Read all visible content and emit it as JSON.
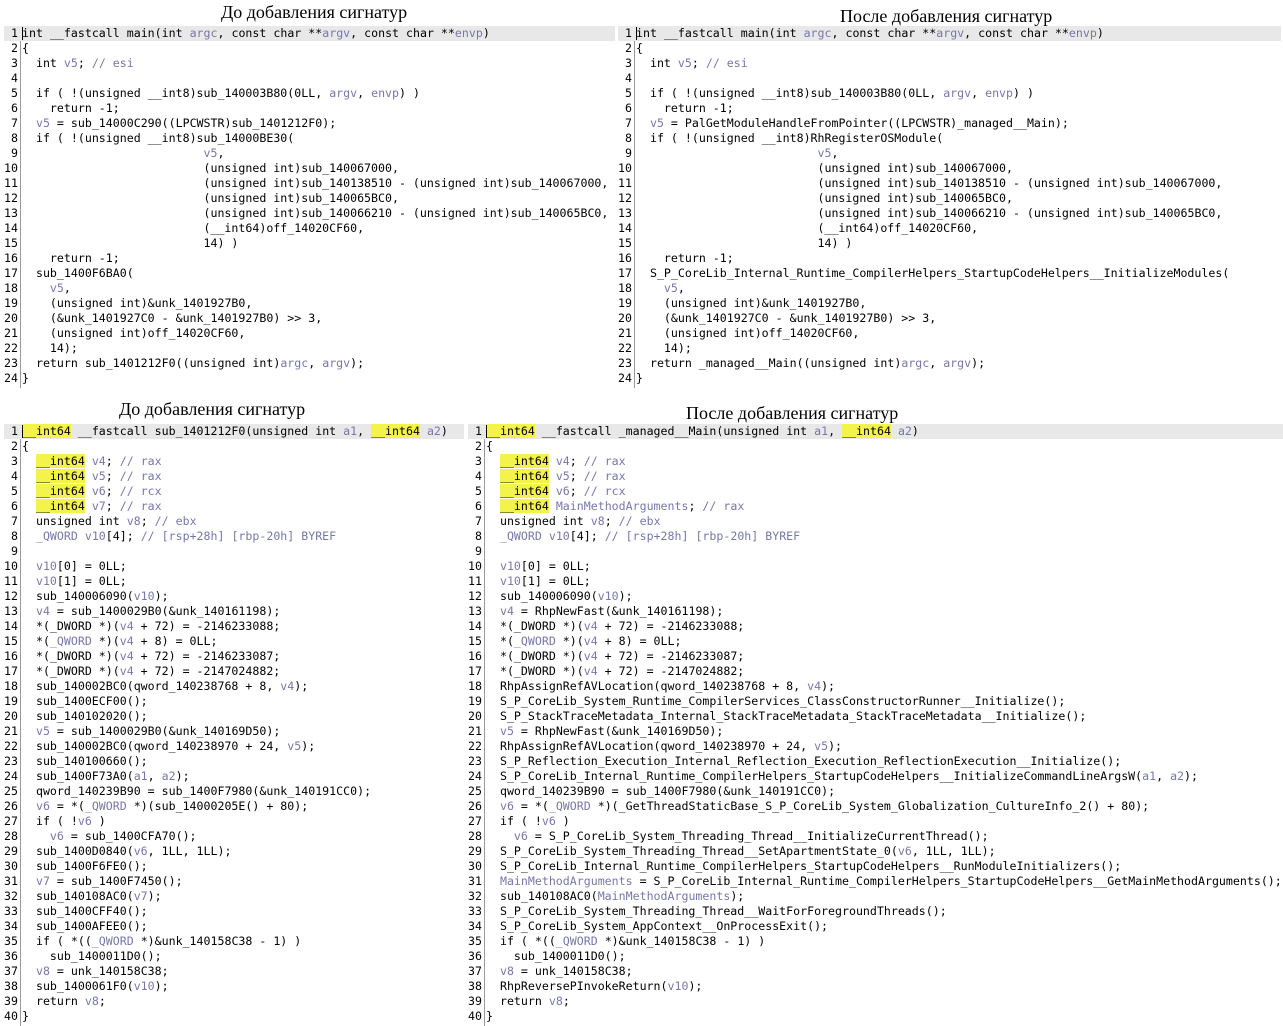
{
  "headings": {
    "top_left": "До добавления сигнатур",
    "top_right": "После добавления сигнатур",
    "bottom_left": "До добавления сигнатур",
    "bottom_right": "После добавления сигнатур"
  },
  "colors": {
    "variable": "#7777aa",
    "type_highlight": "#f3f34a",
    "line_highlight": "#e8e8e8"
  },
  "panes": {
    "top_left": {
      "lines": [
        "int __fastcall main(int argc, const char **argv, const char **envp)",
        "{",
        "  int v5; // esi",
        "",
        "  if ( !(unsigned __int8)sub_140003B80(0LL, argv, envp) )",
        "    return -1;",
        "  v5 = sub_14000C290((LPCWSTR)sub_1401212F0);",
        "  if ( !(unsigned __int8)sub_14000BE30(",
        "                          v5,",
        "                          (unsigned int)sub_140067000,",
        "                          (unsigned int)sub_140138510 - (unsigned int)sub_140067000,",
        "                          (unsigned int)sub_140065BC0,",
        "                          (unsigned int)sub_140066210 - (unsigned int)sub_140065BC0,",
        "                          (__int64)off_14020CF60,",
        "                          14) )",
        "    return -1;",
        "  sub_1400F6BA0(",
        "    v5,",
        "    (unsigned int)&unk_1401927B0,",
        "    (&unk_1401927C0 - &unk_1401927B0) >> 3,",
        "    (unsigned int)off_14020CF60,",
        "    14);",
        "  return sub_1401212F0((unsigned int)argc, argv);",
        "}"
      ]
    },
    "top_right": {
      "lines": [
        "int __fastcall main(int argc, const char **argv, const char **envp)",
        "{",
        "  int v5; // esi",
        "",
        "  if ( !(unsigned __int8)sub_140003B80(0LL, argv, envp) )",
        "    return -1;",
        "  v5 = PalGetModuleHandleFromPointer((LPCWSTR)_managed__Main);",
        "  if ( !(unsigned __int8)RhRegisterOSModule(",
        "                          v5,",
        "                          (unsigned int)sub_140067000,",
        "                          (unsigned int)sub_140138510 - (unsigned int)sub_140067000,",
        "                          (unsigned int)sub_140065BC0,",
        "                          (unsigned int)sub_140066210 - (unsigned int)sub_140065BC0,",
        "                          (__int64)off_14020CF60,",
        "                          14) )",
        "    return -1;",
        "  S_P_CoreLib_Internal_Runtime_CompilerHelpers_StartupCodeHelpers__InitializeModules(",
        "    v5,",
        "    (unsigned int)&unk_1401927B0,",
        "    (&unk_1401927C0 - &unk_1401927B0) >> 3,",
        "    (unsigned int)off_14020CF60,",
        "    14);",
        "  return _managed__Main((unsigned int)argc, argv);",
        "}"
      ]
    },
    "bottom_left": {
      "lines": [
        "__int64 __fastcall sub_1401212F0(unsigned int a1, __int64 a2)",
        "{",
        "  __int64 v4; // rax",
        "  __int64 v5; // rax",
        "  __int64 v6; // rcx",
        "  __int64 v7; // rax",
        "  unsigned int v8; // ebx",
        "  _QWORD v10[4]; // [rsp+28h] [rbp-20h] BYREF",
        "",
        "  v10[0] = 0LL;",
        "  v10[1] = 0LL;",
        "  sub_140006090(v10);",
        "  v4 = sub_1400029B0(&unk_140161198);",
        "  *(_DWORD *)(v4 + 72) = -2146233088;",
        "  *(_QWORD *)(v4 + 8) = 0LL;",
        "  *(_DWORD *)(v4 + 72) = -2146233087;",
        "  *(_DWORD *)(v4 + 72) = -2147024882;",
        "  sub_140002BC0(qword_140238768 + 8, v4);",
        "  sub_1400ECF00();",
        "  sub_140102020();",
        "  v5 = sub_1400029B0(&unk_140169D50);",
        "  sub_140002BC0(qword_140238970 + 24, v5);",
        "  sub_140100660();",
        "  sub_1400F73A0(a1, a2);",
        "  qword_140239B90 = sub_1400F7980(&unk_140191CC0);",
        "  v6 = *(_QWORD *)(sub_14000205E() + 80);",
        "  if ( !v6 )",
        "    v6 = sub_1400CFA70();",
        "  sub_1400D0840(v6, 1LL, 1LL);",
        "  sub_1400F6FE0();",
        "  v7 = sub_1400F7450();",
        "  sub_140108AC0(v7);",
        "  sub_1400CFF40();",
        "  sub_1400AFEE0();",
        "  if ( *((_QWORD *)&unk_140158C38 - 1) )",
        "    sub_1400011D0();",
        "  v8 = unk_140158C38;",
        "  sub_1400061F0(v10);",
        "  return v8;",
        "}"
      ]
    },
    "bottom_right": {
      "lines": [
        "__int64 __fastcall _managed__Main(unsigned int a1, __int64 a2)",
        "{",
        "  __int64 v4; // rax",
        "  __int64 v5; // rax",
        "  __int64 v6; // rcx",
        "  __int64 MainMethodArguments; // rax",
        "  unsigned int v8; // ebx",
        "  _QWORD v10[4]; // [rsp+28h] [rbp-20h] BYREF",
        "",
        "  v10[0] = 0LL;",
        "  v10[1] = 0LL;",
        "  sub_140006090(v10);",
        "  v4 = RhpNewFast(&unk_140161198);",
        "  *(_DWORD *)(v4 + 72) = -2146233088;",
        "  *(_QWORD *)(v4 + 8) = 0LL;",
        "  *(_DWORD *)(v4 + 72) = -2146233087;",
        "  *(_DWORD *)(v4 + 72) = -2147024882;",
        "  RhpAssignRefAVLocation(qword_140238768 + 8, v4);",
        "  S_P_CoreLib_System_Runtime_CompilerServices_ClassConstructorRunner__Initialize();",
        "  S_P_StackTraceMetadata_Internal_StackTraceMetadata_StackTraceMetadata__Initialize();",
        "  v5 = RhpNewFast(&unk_140169D50);",
        "  RhpAssignRefAVLocation(qword_140238970 + 24, v5);",
        "  S_P_Reflection_Execution_Internal_Reflection_Execution_ReflectionExecution__Initialize();",
        "  S_P_CoreLib_Internal_Runtime_CompilerHelpers_StartupCodeHelpers__InitializeCommandLineArgsW(a1, a2);",
        "  qword_140239B90 = sub_1400F7980(&unk_140191CC0);",
        "  v6 = *(_QWORD *)(_GetThreadStaticBase_S_P_CoreLib_System_Globalization_CultureInfo_2() + 80);",
        "  if ( !v6 )",
        "    v6 = S_P_CoreLib_System_Threading_Thread__InitializeCurrentThread();",
        "  S_P_CoreLib_System_Threading_Thread__SetApartmentState_0(v6, 1LL, 1LL);",
        "  S_P_CoreLib_Internal_Runtime_CompilerHelpers_StartupCodeHelpers__RunModuleInitializers();",
        "  MainMethodArguments = S_P_CoreLib_Internal_Runtime_CompilerHelpers_StartupCodeHelpers__GetMainMethodArguments();",
        "  sub_140108AC0(MainMethodArguments);",
        "  S_P_CoreLib_System_Threading_Thread__WaitForForegroundThreads();",
        "  S_P_CoreLib_System_AppContext__OnProcessExit();",
        "  if ( *((_QWORD *)&unk_140158C38 - 1) )",
        "    sub_1400011D0();",
        "  v8 = unk_140158C38;",
        "  RhpReversePInvokeReturn(v10);",
        "  return v8;",
        "}"
      ]
    }
  }
}
